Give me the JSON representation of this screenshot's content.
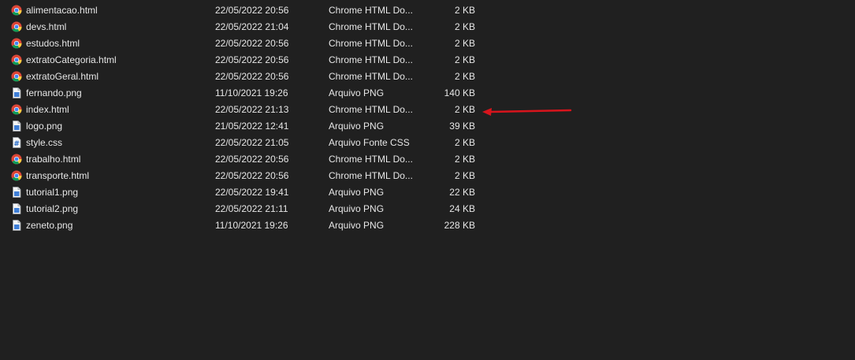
{
  "files": [
    {
      "name": "alimentacao.html",
      "date": "22/05/2022 20:56",
      "type": "Chrome HTML Do...",
      "size": "2 KB",
      "icon": "chrome-icon"
    },
    {
      "name": "devs.html",
      "date": "22/05/2022 21:04",
      "type": "Chrome HTML Do...",
      "size": "2 KB",
      "icon": "chrome-icon"
    },
    {
      "name": "estudos.html",
      "date": "22/05/2022 20:56",
      "type": "Chrome HTML Do...",
      "size": "2 KB",
      "icon": "chrome-icon"
    },
    {
      "name": "extratoCategoria.html",
      "date": "22/05/2022 20:56",
      "type": "Chrome HTML Do...",
      "size": "2 KB",
      "icon": "chrome-icon"
    },
    {
      "name": "extratoGeral.html",
      "date": "22/05/2022 20:56",
      "type": "Chrome HTML Do...",
      "size": "2 KB",
      "icon": "chrome-icon"
    },
    {
      "name": "fernando.png",
      "date": "11/10/2021 19:26",
      "type": "Arquivo PNG",
      "size": "140 KB",
      "icon": "image-file-icon"
    },
    {
      "name": "index.html",
      "date": "22/05/2022 21:13",
      "type": "Chrome HTML Do...",
      "size": "2 KB",
      "icon": "chrome-icon"
    },
    {
      "name": "logo.png",
      "date": "21/05/2022 12:41",
      "type": "Arquivo PNG",
      "size": "39 KB",
      "icon": "image-file-icon"
    },
    {
      "name": "style.css",
      "date": "22/05/2022 21:05",
      "type": "Arquivo Fonte CSS",
      "size": "2 KB",
      "icon": "css-file-icon"
    },
    {
      "name": "trabalho.html",
      "date": "22/05/2022 20:56",
      "type": "Chrome HTML Do...",
      "size": "2 KB",
      "icon": "chrome-icon"
    },
    {
      "name": "transporte.html",
      "date": "22/05/2022 20:56",
      "type": "Chrome HTML Do...",
      "size": "2 KB",
      "icon": "chrome-icon"
    },
    {
      "name": "tutorial1.png",
      "date": "22/05/2022 19:41",
      "type": "Arquivo PNG",
      "size": "22 KB",
      "icon": "image-file-icon"
    },
    {
      "name": "tutorial2.png",
      "date": "22/05/2022 21:11",
      "type": "Arquivo PNG",
      "size": "24 KB",
      "icon": "image-file-icon"
    },
    {
      "name": "zeneto.png",
      "date": "11/10/2021 19:26",
      "type": "Arquivo PNG",
      "size": "228 KB",
      "icon": "image-file-icon"
    }
  ],
  "colors": {
    "background": "#202020",
    "text": "#e6e6e6",
    "arrow": "#d8141c"
  },
  "annotation": {
    "icon": "red-arrow-icon",
    "points_to": "index.html"
  }
}
